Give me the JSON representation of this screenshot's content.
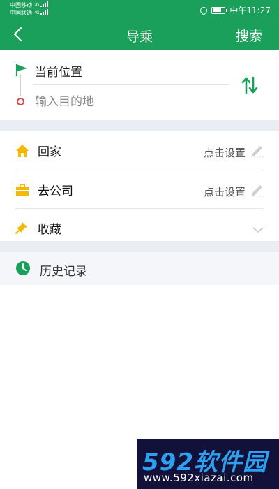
{
  "status_bar": {
    "carrier1": "中国移动",
    "carrier1_net": "2G",
    "carrier2": "中国联通",
    "carrier2_net": "4G",
    "time": "中午11:27"
  },
  "header": {
    "title": "导乘",
    "search_label": "搜索"
  },
  "route": {
    "origin": "当前位置",
    "destination_placeholder": "输入目的地"
  },
  "places": [
    {
      "label": "回家",
      "action": "点击设置"
    },
    {
      "label": "去公司",
      "action": "点击设置"
    },
    {
      "label": "收藏"
    }
  ],
  "history": {
    "label": "历史记录"
  },
  "watermark": {
    "main": "592软件园",
    "url": "www.592xiazai.com"
  },
  "colors": {
    "accent": "#1aa05a",
    "home_icon": "#f5b800",
    "destination_marker": "#e0474c",
    "watermark_bg": "#12113a",
    "watermark_text": "#2ea0f0"
  }
}
